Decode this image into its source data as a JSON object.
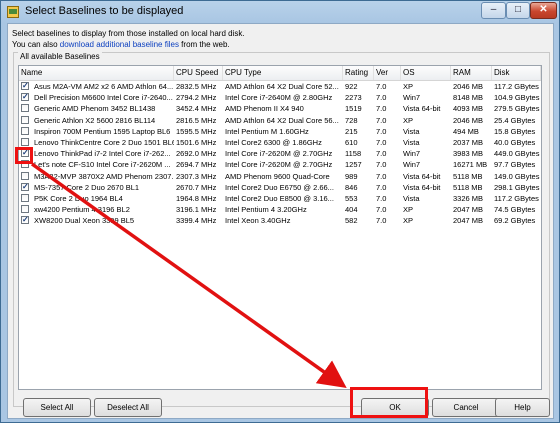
{
  "window": {
    "title": "Select Baselines to be displayed",
    "buttons": {
      "minimize": "–",
      "maximize": "□",
      "close": "✕"
    }
  },
  "intro": {
    "line1": "Select baselines to display from those installed on local hard disk.",
    "line2_prefix": "You can also ",
    "line2_link": "download additional baseline files",
    "line2_suffix": " from the web."
  },
  "group": {
    "label": "All available Baselines"
  },
  "columns": [
    "Name",
    "CPU Speed",
    "CPU Type",
    "Rating",
    "Ver",
    "OS",
    "RAM",
    "Disk"
  ],
  "rows": [
    {
      "checked": true,
      "name": "Asus M2A-VM AM2 x2 6 AMD Athlon 64...",
      "speed": "2832.5 MHz",
      "cpu": "AMD Athlon 64 X2 Dual Core 52...",
      "rating": "922",
      "ver": "7.0",
      "os": "XP",
      "ram": "2046 MB",
      "disk": "117.2 GBytes"
    },
    {
      "checked": true,
      "name": "Dell Precision M6600 Intel Core i7-2640...",
      "speed": "2794.2 MHz",
      "cpu": "Intel Core i7-2640M @ 2.80GHz",
      "rating": "2273",
      "ver": "7.0",
      "os": "Win7",
      "ram": "8148 MB",
      "disk": "104.9 GBytes"
    },
    {
      "checked": false,
      "name": "Generic AMD Phenom 3452 BL1438",
      "speed": "3452.4 MHz",
      "cpu": "AMD Phenom II X4 940",
      "rating": "1519",
      "ver": "7.0",
      "os": "Vista 64-bit",
      "ram": "4093 MB",
      "disk": "279.5 GBytes"
    },
    {
      "checked": false,
      "name": "Generic Athlon X2 5600 2816 BL114",
      "speed": "2816.5 MHz",
      "cpu": "AMD Athlon 64 X2 Dual Core 56...",
      "rating": "728",
      "ver": "7.0",
      "os": "XP",
      "ram": "2046 MB",
      "disk": "25.4 GBytes"
    },
    {
      "checked": false,
      "name": "Inspiron 700M Pentium 1595 Laptop BL6",
      "speed": "1595.5 MHz",
      "cpu": "Intel Pentium M 1.60GHz",
      "rating": "215",
      "ver": "7.0",
      "os": "Vista",
      "ram": "494 MB",
      "disk": "15.8 GBytes"
    },
    {
      "checked": false,
      "name": "Lenovo ThinkCentre   Core 2 Duo 1501 BL6",
      "speed": "1501.6 MHz",
      "cpu": "Intel Core2 6300 @ 1.86GHz",
      "rating": "610",
      "ver": "7.0",
      "os": "Vista",
      "ram": "2037 MB",
      "disk": "40.0 GBytes"
    },
    {
      "checked": true,
      "name": "Lenovo ThinkPad i7-2 Intel Core i7-262...",
      "speed": "2692.0 MHz",
      "cpu": "Intel Core i7-2620M @ 2.70GHz",
      "rating": "1158",
      "ver": "7.0",
      "os": "Win7",
      "ram": "3983 MB",
      "disk": "449.0 GBytes"
    },
    {
      "checked": false,
      "name": "Let's note CF-S10 Intel Core i7-2620M ...",
      "speed": "2694.7 MHz",
      "cpu": "Intel Core i7-2620M @ 2.70GHz",
      "rating": "1257",
      "ver": "7.0",
      "os": "Win7",
      "ram": "16271 MB",
      "disk": "97.7 GBytes"
    },
    {
      "checked": false,
      "name": "M3A32-MVP 3870X2 AMD Phenom 2307...",
      "speed": "2307.3 MHz",
      "cpu": "AMD Phenom 9600 Quad-Core",
      "rating": "989",
      "ver": "7.0",
      "os": "Vista 64-bit",
      "ram": "5118 MB",
      "disk": "149.0 GBytes"
    },
    {
      "checked": true,
      "name": "MS-7357 Core 2 Duo 2670 BL1",
      "speed": "2670.7 MHz",
      "cpu": "Intel Core2 Duo E6750 @ 2.66...",
      "rating": "846",
      "ver": "7.0",
      "os": "Vista 64-bit",
      "ram": "5118 MB",
      "disk": "298.1 GBytes"
    },
    {
      "checked": false,
      "name": "P5K Core 2 Duo 1964 BL4",
      "speed": "1964.8 MHz",
      "cpu": "Intel Core2 Duo E8500 @ 3.16...",
      "rating": "553",
      "ver": "7.0",
      "os": "Vista",
      "ram": "3326 MB",
      "disk": "117.2 GBytes"
    },
    {
      "checked": false,
      "name": "xw4200 Pentium 4 3196 BL2",
      "speed": "3196.1 MHz",
      "cpu": "Intel Pentium 4 3.20GHz",
      "rating": "404",
      "ver": "7.0",
      "os": "XP",
      "ram": "2047 MB",
      "disk": "74.5 GBytes"
    },
    {
      "checked": true,
      "name": "XW8200 Dual Xeon 3399 BL5",
      "speed": "3399.4 MHz",
      "cpu": "Intel Xeon 3.40GHz",
      "rating": "582",
      "ver": "7.0",
      "os": "XP",
      "ram": "2047 MB",
      "disk": "69.2 GBytes"
    }
  ],
  "buttons": {
    "select_all": "Select All",
    "deselect_all": "Deselect All",
    "ok": "OK",
    "cancel": "Cancel",
    "help": "Help"
  },
  "annotation": {
    "color": "#e11111"
  }
}
